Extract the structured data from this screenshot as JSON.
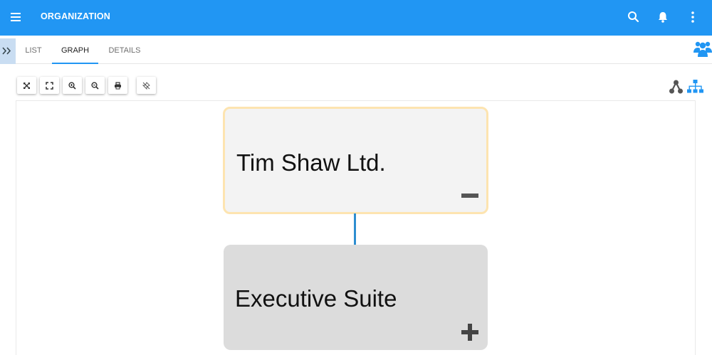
{
  "header": {
    "title": "ORGANIZATION",
    "accent_color": "#2196f3",
    "icons": [
      "menu-icon",
      "search-icon",
      "bell-icon",
      "more-vert-icon"
    ]
  },
  "tabs": [
    {
      "label": "LIST",
      "active": false
    },
    {
      "label": "GRAPH",
      "active": true
    },
    {
      "label": "DETAILS",
      "active": false
    }
  ],
  "toolbar": {
    "buttons": [
      "expand-arrows-icon",
      "fullscreen-icon",
      "zoom-in-icon",
      "zoom-out-icon",
      "print-icon",
      "pin-off-icon"
    ],
    "layout_icons": [
      "tree-layout-icon",
      "hierarchy-layout-icon"
    ]
  },
  "graph": {
    "root": {
      "label": "Tim Shaw Ltd.",
      "toggle": "collapse",
      "border_color": "#fde4b0"
    },
    "child": {
      "label": "Executive Suite",
      "toggle": "expand"
    },
    "connector_color": "#2d8ed0"
  }
}
